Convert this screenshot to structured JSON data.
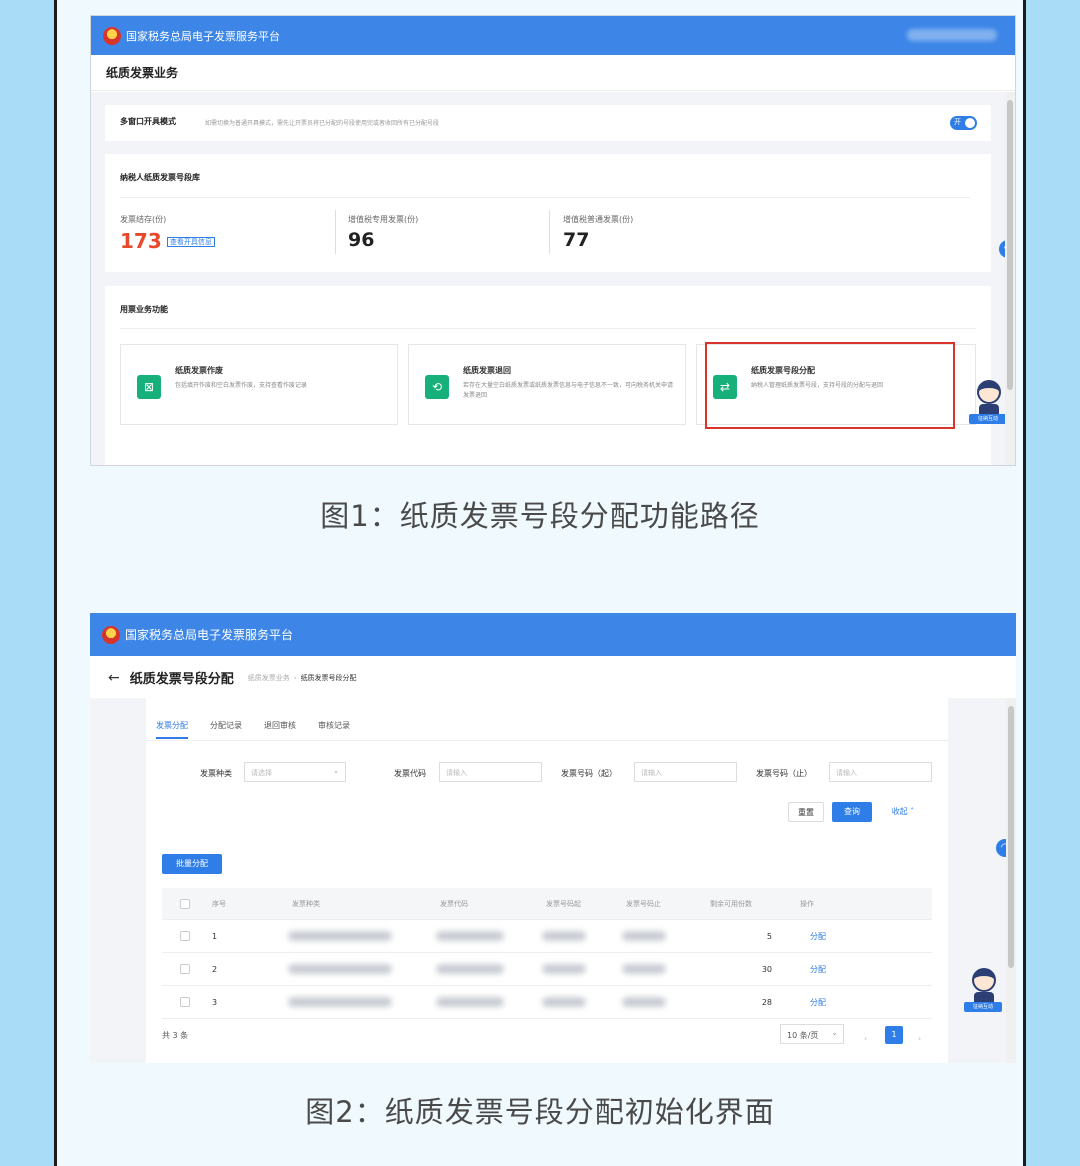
{
  "screen1": {
    "platform_title": "国家税务总局电子发票服务平台",
    "page_title": "纸质发票业务",
    "multi_window": {
      "label": "多窗口开具模式",
      "desc": "如需切换为普通开具模式，需先让开票员将已分配的号段使用完或者收回所有已分配号段",
      "toggle_text": "开"
    },
    "stock": {
      "title": "纳税人纸质发票号段库",
      "items": [
        {
          "label": "发票结存(份)",
          "value": "173"
        },
        {
          "label": "增值税专用发票(份)",
          "value": "96"
        },
        {
          "label": "增值税普通发票(份)",
          "value": "77"
        }
      ],
      "view_link": "查看开具信息",
      "accent_color": "#e8492c"
    },
    "functions": {
      "title": "用票业务功能",
      "items": [
        {
          "title": "纸质发票作废",
          "desc": "包括填开作废和空白发票作废，支持查看作废记录"
        },
        {
          "title": "纸质发票退回",
          "desc": "若存在大量空白纸质发票或纸质发票信息与电子信息不一致，可向税务机关申请发票退回"
        },
        {
          "title": "纸质发票号段分配",
          "desc": "纳税人管理纸质发票号段，支持号段的分配与退回"
        }
      ],
      "highlight_color": "#d9342b"
    },
    "assistant_tag": "征纳互动"
  },
  "caption1": "图1：纸质发票号段分配功能路径",
  "screen2": {
    "platform_title": "国家税务总局电子发票服务平台",
    "back_arrow": "←",
    "page_title": "纸质发票号段分配",
    "breadcrumb": [
      "纸质发票业务",
      "纸质发票号段分配"
    ],
    "breadcrumb_sep": "›",
    "tabs": [
      "发票分配",
      "分配记录",
      "退回审核",
      "审核记录"
    ],
    "active_tab": "发票分配",
    "filters": {
      "type_label": "发票种类",
      "type_placeholder": "请选择",
      "code_label": "发票代码",
      "code_placeholder": "请输入",
      "start_label": "发票号码（起）",
      "start_placeholder": "请输入",
      "end_label": "发票号码（止）",
      "end_placeholder": "请输入"
    },
    "buttons": {
      "reset": "重置",
      "query": "查询",
      "collapse": "收起",
      "batch": "批量分配"
    },
    "table": {
      "headers": [
        "序号",
        "发票种类",
        "发票代码",
        "发票号码起",
        "发票号码止",
        "剩余可用份数",
        "操作"
      ],
      "rows": [
        {
          "index": "1",
          "remaining": "5",
          "action": "分配"
        },
        {
          "index": "2",
          "remaining": "30",
          "action": "分配"
        },
        {
          "index": "3",
          "remaining": "28",
          "action": "分配"
        }
      ]
    },
    "total": "共 3 条",
    "page_size": "10 条/页",
    "current_page": "1",
    "assistant_tag": "征纳互动"
  },
  "caption2": "图2：纸质发票号段分配初始化界面",
  "colors": {
    "brand_blue": "#3d86e8",
    "page_bg": "#a9dcf6",
    "green": "#17b07a"
  }
}
